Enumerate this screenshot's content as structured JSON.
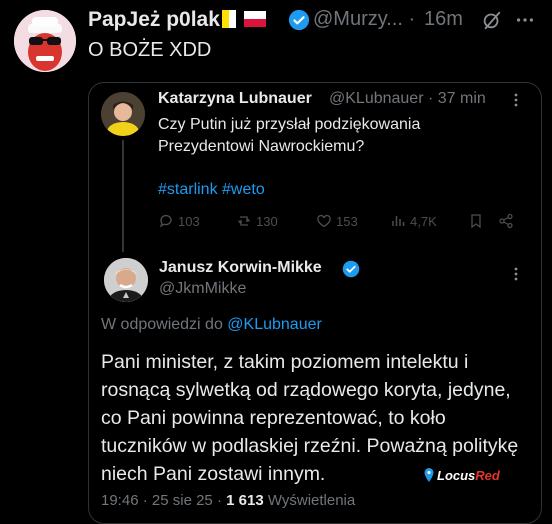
{
  "outer_tweet": {
    "author_name": "PapJeż p0lak",
    "handle": "@Murzy...",
    "separator": "·",
    "time": "16m",
    "text": "O BOŻE XDD"
  },
  "quoted_post": {
    "author_name": "Katarzyna Lubnauer",
    "handle": "@KLubnauer",
    "separator": "·",
    "time": "37 min",
    "text": "Czy Putin już przysłał podziękowania Prezydentowi Nawrockiemu?",
    "hashtags": "#starlink #weto",
    "replies": "103",
    "reposts": "130",
    "likes": "153",
    "views": "4,7K"
  },
  "reply_post": {
    "author_name": "Janusz Korwin-Mikke",
    "handle": "@JkmMikke",
    "reply_prefix": "W odpowiedzi do",
    "reply_mention": "@KLubnauer",
    "text": "Pani minister, z takim poziomem intelektu i rosnącą sylwetką od rządowego koryta, jedyne, co Pani powinna reprezentować, to koło tuczników w podlaskiej rzeźni. Poważną politykę niech Pani zostawi innym.",
    "time": "19:46",
    "date": "25 sie 25",
    "views_count": "1 613",
    "views_label": "Wyświetlenia",
    "dot": "·"
  },
  "watermark": {
    "text_main": "Locus",
    "text_accent": "Red"
  },
  "colors": {
    "accent_blue": "#1d9bf0",
    "muted": "#71767b",
    "text": "#e7e9ea",
    "background": "#000000"
  }
}
